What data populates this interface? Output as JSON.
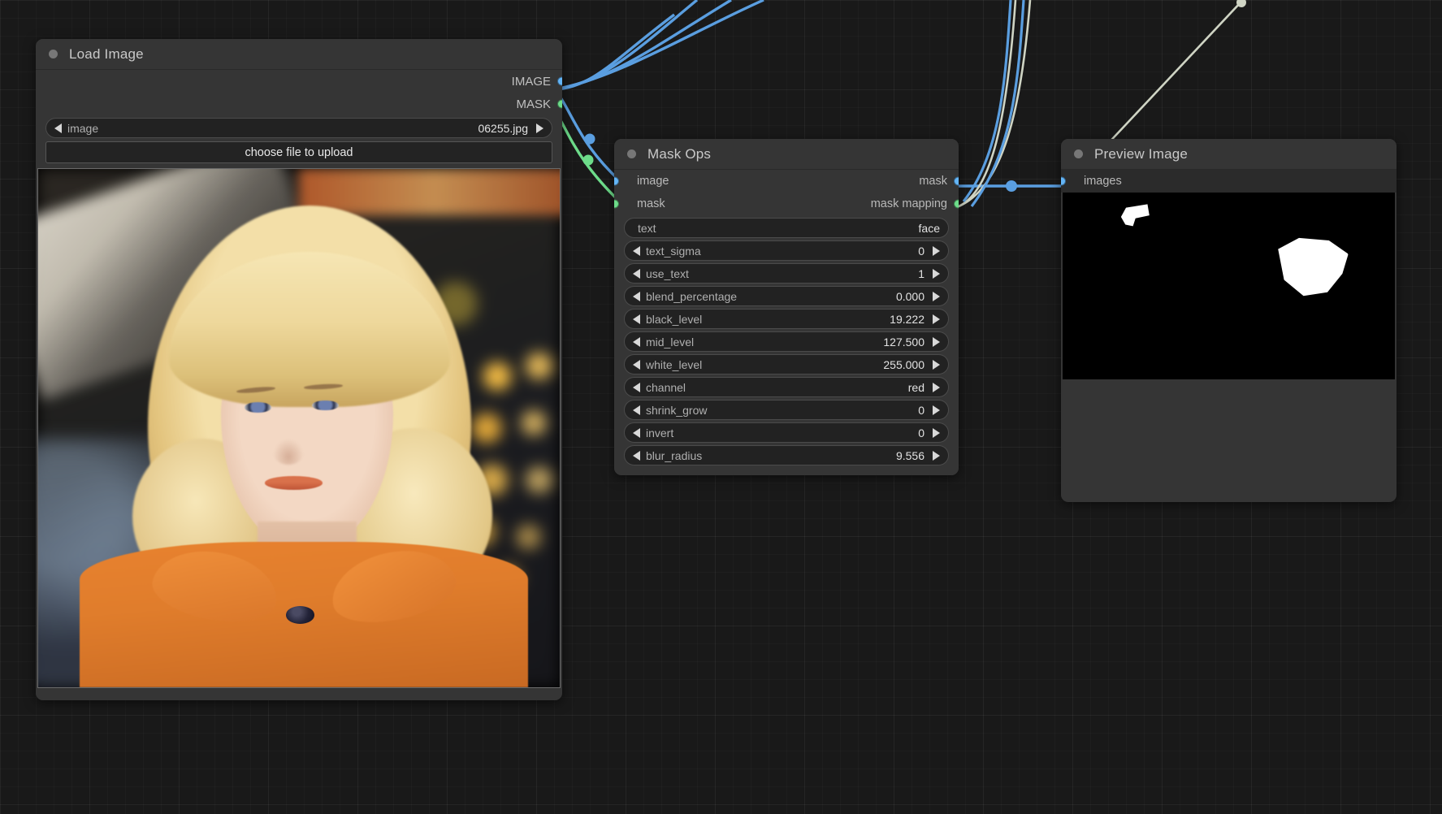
{
  "canvas": {
    "background_color": "#191919",
    "grid_color": "#242424"
  },
  "nodes": [
    {
      "id": "load-image",
      "title": "Load Image",
      "outputs": [
        {
          "label": "IMAGE",
          "type": "IMAGE",
          "color": "#64b5f6"
        },
        {
          "label": "MASK",
          "type": "MASK",
          "color": "#6ddc8a"
        }
      ],
      "widgets": [
        {
          "name": "image",
          "value": "06255.jpg",
          "kind": "combo"
        }
      ],
      "button_label": "choose file to upload",
      "preview_alt": "portrait of a blonde woman in an orange coat on a city street"
    },
    {
      "id": "mask-ops",
      "title": "Mask Ops",
      "inputs": [
        {
          "label": "image",
          "type": "IMAGE",
          "color": "#64b5f6"
        },
        {
          "label": "mask",
          "type": "MASK",
          "color": "#6ddc8a"
        }
      ],
      "outputs": [
        {
          "label": "mask",
          "type": "MASK",
          "color": "#64b5f6"
        },
        {
          "label": "mask mapping",
          "type": "MASK_MAPPING",
          "color": "#6ddc8a"
        }
      ],
      "widgets": [
        {
          "name": "text",
          "value": "face",
          "kind": "text"
        },
        {
          "name": "text_sigma",
          "value": "0",
          "kind": "number"
        },
        {
          "name": "use_text",
          "value": "1",
          "kind": "number"
        },
        {
          "name": "blend_percentage",
          "value": "0.000",
          "kind": "number"
        },
        {
          "name": "black_level",
          "value": "19.222",
          "kind": "number"
        },
        {
          "name": "mid_level",
          "value": "127.500",
          "kind": "number"
        },
        {
          "name": "white_level",
          "value": "255.000",
          "kind": "number"
        },
        {
          "name": "channel",
          "value": "red",
          "kind": "combo"
        },
        {
          "name": "shrink_grow",
          "value": "0",
          "kind": "number"
        },
        {
          "name": "invert",
          "value": "0",
          "kind": "number"
        },
        {
          "name": "blur_radius",
          "value": "9.556",
          "kind": "number"
        }
      ]
    },
    {
      "id": "preview-image",
      "title": "Preview Image",
      "inputs": [
        {
          "label": "images",
          "type": "IMAGE",
          "color": "#64b5f6"
        }
      ],
      "preview_alt": "black and white binary mask with two white blobs"
    }
  ],
  "links": [
    {
      "from": "load-image.IMAGE",
      "to": "mask-ops.image",
      "color": "#5a9ee0"
    },
    {
      "from": "load-image.MASK",
      "to": "mask-ops.mask",
      "color": "#6ddc8a"
    },
    {
      "from": "mask-ops.mask",
      "to": "preview-image.images",
      "color": "#5a9ee0"
    },
    {
      "from": "mask-ops.mask mapping",
      "to": "offscreen",
      "color": "#cfd4c4"
    }
  ]
}
